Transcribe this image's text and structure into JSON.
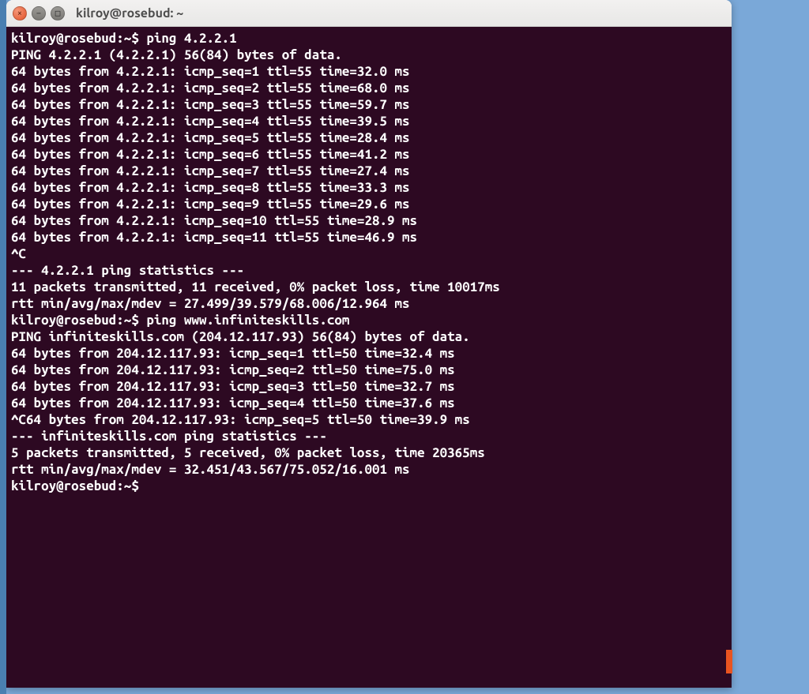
{
  "window": {
    "title": "kilroy@rosebud: ~"
  },
  "terminal": {
    "prompt1_userhost": "kilroy@rosebud",
    "prompt1_path": ":~$",
    "command1": " ping 4.2.2.1",
    "ping1_header": "PING 4.2.2.1 (4.2.2.1) 56(84) bytes of data.",
    "ping1_lines": [
      "64 bytes from 4.2.2.1: icmp_seq=1 ttl=55 time=32.0 ms",
      "64 bytes from 4.2.2.1: icmp_seq=2 ttl=55 time=68.0 ms",
      "64 bytes from 4.2.2.1: icmp_seq=3 ttl=55 time=59.7 ms",
      "64 bytes from 4.2.2.1: icmp_seq=4 ttl=55 time=39.5 ms",
      "64 bytes from 4.2.2.1: icmp_seq=5 ttl=55 time=28.4 ms",
      "64 bytes from 4.2.2.1: icmp_seq=6 ttl=55 time=41.2 ms",
      "64 bytes from 4.2.2.1: icmp_seq=7 ttl=55 time=27.4 ms",
      "64 bytes from 4.2.2.1: icmp_seq=8 ttl=55 time=33.3 ms",
      "64 bytes from 4.2.2.1: icmp_seq=9 ttl=55 time=29.6 ms",
      "64 bytes from 4.2.2.1: icmp_seq=10 ttl=55 time=28.9 ms",
      "64 bytes from 4.2.2.1: icmp_seq=11 ttl=55 time=46.9 ms"
    ],
    "ctrlc1": "^C",
    "stats1_header": "--- 4.2.2.1 ping statistics ---",
    "stats1_line1": "11 packets transmitted, 11 received, 0% packet loss, time 10017ms",
    "stats1_line2": "rtt min/avg/max/mdev = 27.499/39.579/68.006/12.964 ms",
    "prompt2_userhost": "kilroy@rosebud",
    "prompt2_path": ":~$",
    "command2": " ping www.infiniteskills.com",
    "ping2_header": "PING infiniteskills.com (204.12.117.93) 56(84) bytes of data.",
    "ping2_lines": [
      "64 bytes from 204.12.117.93: icmp_seq=1 ttl=50 time=32.4 ms",
      "64 bytes from 204.12.117.93: icmp_seq=2 ttl=50 time=75.0 ms",
      "64 bytes from 204.12.117.93: icmp_seq=3 ttl=50 time=32.7 ms",
      "64 bytes from 204.12.117.93: icmp_seq=4 ttl=50 time=37.6 ms"
    ],
    "ctrlc2_line": "^C64 bytes from 204.12.117.93: icmp_seq=5 ttl=50 time=39.9 ms",
    "blank": "",
    "stats2_header": "--- infiniteskills.com ping statistics ---",
    "stats2_line1": "5 packets transmitted, 5 received, 0% packet loss, time 20365ms",
    "stats2_line2": "rtt min/avg/max/mdev = 32.451/43.567/75.052/16.001 ms",
    "prompt3_userhost": "kilroy@rosebud",
    "prompt3_path": ":~$",
    "command3": " "
  }
}
